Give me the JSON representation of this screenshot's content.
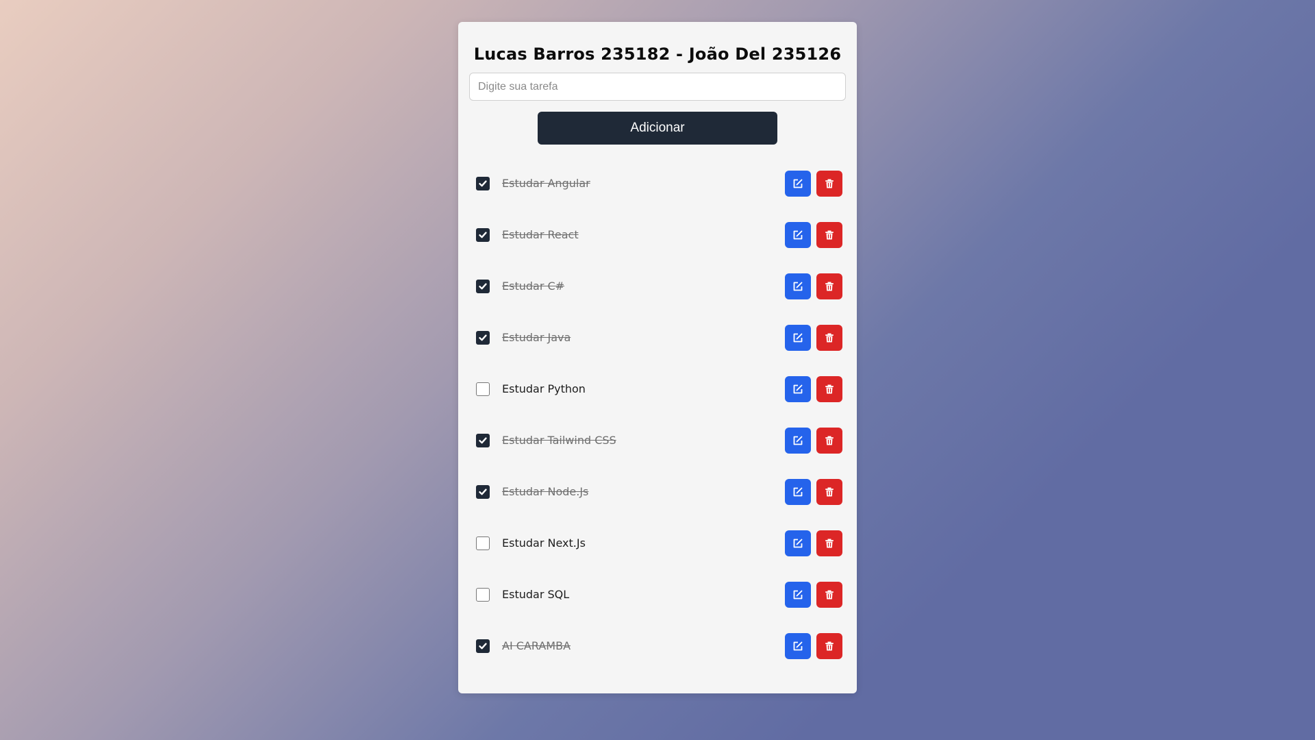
{
  "header": {
    "title": "Lucas Barros 235182 - João Del 235126"
  },
  "form": {
    "input_placeholder": "Digite sua tarefa",
    "input_value": "",
    "add_label": "Adicionar"
  },
  "colors": {
    "primary_dark": "#1f2937",
    "edit_blue": "#2563eb",
    "delete_red": "#dc2626"
  },
  "icons": {
    "edit": "edit-icon",
    "delete": "trash-icon",
    "check": "check-icon"
  },
  "tasks": [
    {
      "label": "Estudar Angular",
      "completed": true
    },
    {
      "label": "Estudar React",
      "completed": true
    },
    {
      "label": "Estudar C#",
      "completed": true
    },
    {
      "label": "Estudar Java",
      "completed": true
    },
    {
      "label": "Estudar Python",
      "completed": false
    },
    {
      "label": "Estudar Tailwind CSS",
      "completed": true
    },
    {
      "label": "Estudar Node.Js",
      "completed": true
    },
    {
      "label": "Estudar Next.Js",
      "completed": false
    },
    {
      "label": "Estudar SQL",
      "completed": false
    },
    {
      "label": "AI CARAMBA",
      "completed": true
    }
  ]
}
